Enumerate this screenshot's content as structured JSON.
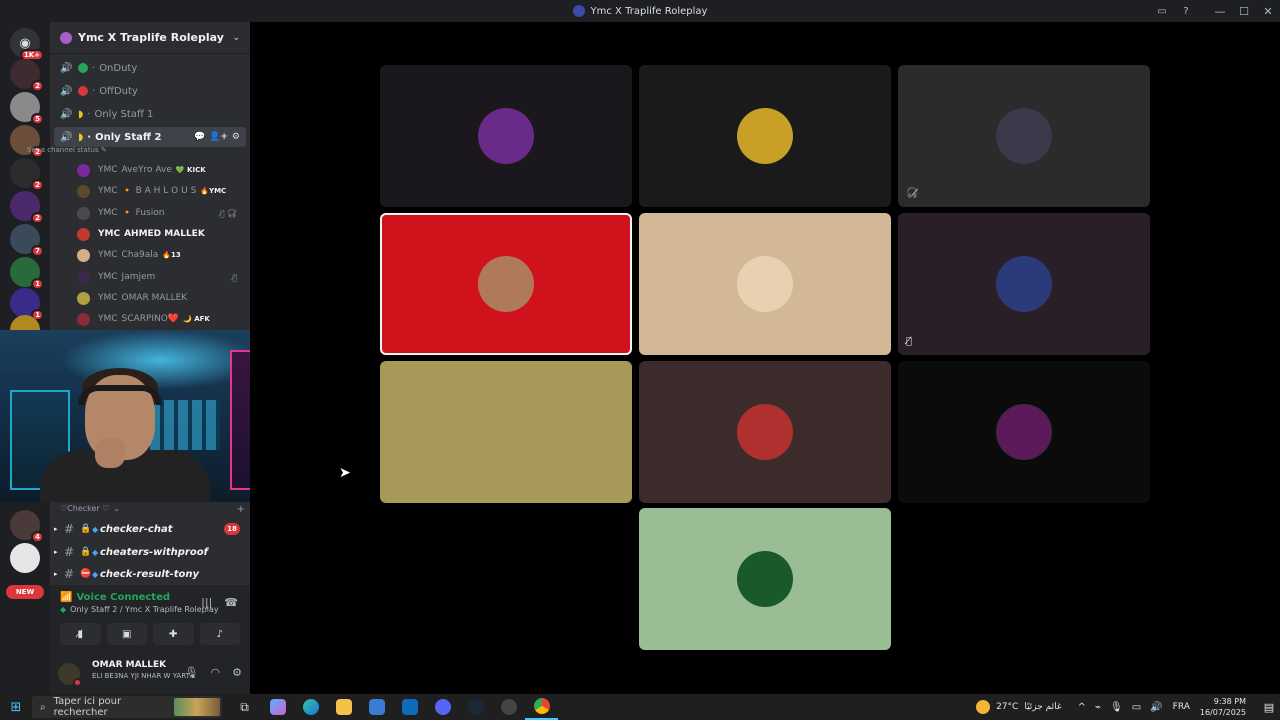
{
  "window": {
    "title": "Ymc X Traplife Roleplay",
    "controls": [
      "—",
      "☐",
      "✕"
    ]
  },
  "guilds": {
    "home_badge": "1K+",
    "items": [
      {
        "badge": "2",
        "color": "#3d2b30"
      },
      {
        "badge": "5",
        "color": "#8a8a8a"
      },
      {
        "badge": "2",
        "color": "#6b4e3a"
      },
      {
        "badge": "2",
        "color": "#2c2c2c"
      },
      {
        "badge": "2",
        "color": "#4a2a6a"
      },
      {
        "badge": "7",
        "color": "#3a4a5a"
      },
      {
        "badge": "1",
        "color": "#2a6a3a"
      },
      {
        "badge": "1",
        "color": "#3a2a8a"
      },
      {
        "badge": "",
        "color": "#b08a20"
      }
    ],
    "lower_items": [
      {
        "badge": "4",
        "color": "#4a3a3a"
      },
      {
        "badge": "",
        "color": "#e6e6e6"
      }
    ],
    "new_label": "NEW"
  },
  "sidebar": {
    "server_name": "Ymc X Traplife Roleplay",
    "voice_channels": [
      {
        "name": "OnDuty",
        "dot_color": "#23a55a"
      },
      {
        "name": "OffDuty",
        "dot_color": "#da373c"
      },
      {
        "name": "Only Staff 1",
        "dot_color": ""
      },
      {
        "name": "Only Staff 2",
        "dot_color": "",
        "active": true
      }
    ],
    "channel_status": "Set a channel status",
    "members": [
      {
        "prefix": "YMC",
        "name": "AveYro Ave",
        "tag": "💚 KICK",
        "color": "#7a2a9a",
        "bright": false,
        "mic_off": ""
      },
      {
        "prefix": "YMC",
        "name": "🔸 B A H L O U S",
        "tag": "🔥YMC",
        "color": "#5a4a2a",
        "bright": false,
        "mic_off": ""
      },
      {
        "prefix": "YMC",
        "name": "🔸 Fusion",
        "tag": "",
        "color": "#4a4a4a",
        "bright": false,
        "mic_off": "🎙̸ 🎧̸"
      },
      {
        "prefix": "YMC",
        "name": "AHMED MALLEK",
        "tag": "",
        "color": "#c0392b",
        "bright": true,
        "mic_off": ""
      },
      {
        "prefix": "YMC",
        "name": "Cha9ala",
        "tag": "🔥13",
        "color": "#d4b08a",
        "bright": false,
        "mic_off": ""
      },
      {
        "prefix": "YMC",
        "name": "Jamjem",
        "tag": "",
        "color": "#3a2a4a",
        "bright": false,
        "mic_off": "🎙̸"
      },
      {
        "prefix": "YMC",
        "name": "OMAR MALLEK",
        "tag": "",
        "color": "#b0a040",
        "bright": false,
        "mic_off": ""
      },
      {
        "prefix": "YMC",
        "name": "SCARPINO❤️",
        "tag": "🌙 AFK",
        "color": "#8a2a3a",
        "bright": false,
        "mic_off": ""
      }
    ],
    "category_label": "♡Checker ♡",
    "text_channels": [
      {
        "name": "checker-chat",
        "icon": "🔒",
        "count": "18"
      },
      {
        "name": "cheaters-withproof",
        "icon": "🔒",
        "count": ""
      },
      {
        "name": "check-result-tony",
        "icon": "⛔",
        "count": ""
      }
    ]
  },
  "voice_panel": {
    "title": "Voice Connected",
    "subtitle": "Only Staff 2 / Ymc X Traplife Roleplay",
    "actions": [
      "camera-off",
      "screen-share",
      "activity",
      "soundboard"
    ]
  },
  "user_panel": {
    "name": "OMAR MALLEK",
    "status": "ELI BE3NA YJI NHAR W YART..."
  },
  "tiles": [
    {
      "bg": "#1a181c",
      "avatar": "#6a2a8a",
      "speaking": false,
      "mute": ""
    },
    {
      "bg": "#1a1a1a",
      "avatar": "#c8a028",
      "speaking": false,
      "mute": ""
    },
    {
      "bg": "#2b2b2b",
      "avatar": "#3a3a4a",
      "speaking": false,
      "mute": "🎧̸"
    },
    {
      "bg": "#d0121c",
      "avatar": "#b07a5a",
      "speaking": true,
      "mute": ""
    },
    {
      "bg": "#d3b898",
      "avatar": "#e8d0b0",
      "speaking": false,
      "mute": ""
    },
    {
      "bg": "#2a1f26",
      "avatar": "#2a3a7a",
      "speaking": false,
      "mute": "🎙̸"
    },
    {
      "bg": "#a79a58",
      "avatar": "#a79a58",
      "speaking": false,
      "mute": ""
    },
    {
      "bg": "#3d2a2a",
      "avatar": "#b03030",
      "speaking": false,
      "mute": ""
    },
    {
      "bg": "#0b0b0b",
      "avatar": "#5a1a5a",
      "speaking": false,
      "mute": ""
    },
    {
      "bg": "#9bbd96",
      "avatar": "#1a5a2a",
      "speaking": false,
      "mute": ""
    }
  ],
  "taskbar": {
    "search_placeholder": "Taper ici pour rechercher",
    "weather": "27°C",
    "weather_text": "غائم جزئيًا",
    "lang": "FRA",
    "time": "9:38 PM",
    "date": "16/07/2025"
  }
}
